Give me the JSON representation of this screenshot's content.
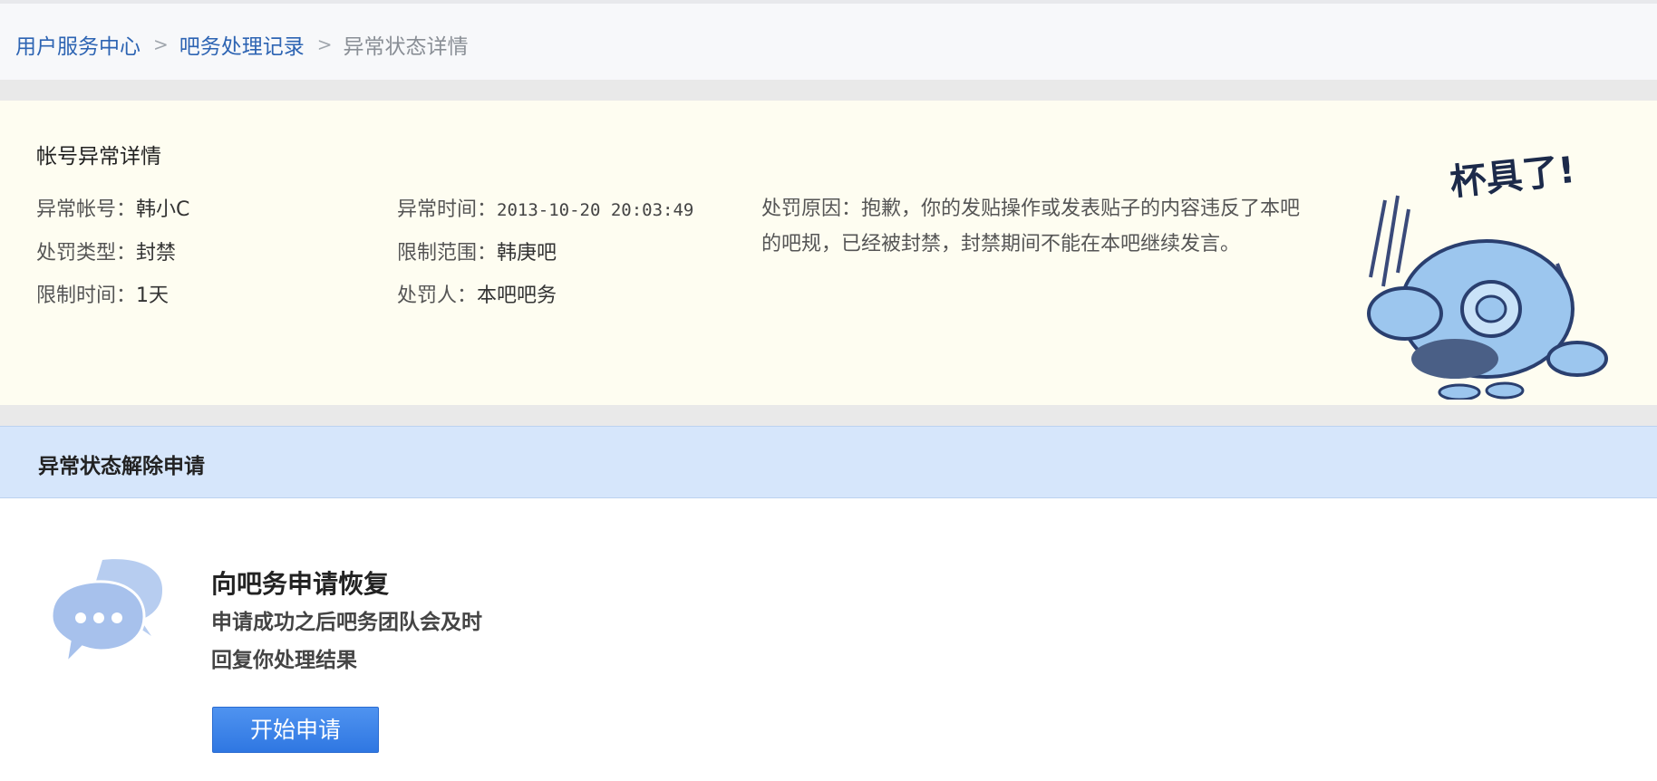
{
  "breadcrumb": {
    "items": [
      {
        "label": "用户服务中心"
      },
      {
        "label": "吧务处理记录"
      }
    ],
    "separator": ">",
    "current": "异常状态详情"
  },
  "detail": {
    "title": "帐号异常详情",
    "account_label": "异常帐号：",
    "account_value": "韩小C",
    "type_label": "处罚类型：",
    "type_value": "封禁",
    "duration_label": "限制时间：",
    "duration_value": "1天",
    "time_label": "异常时间：",
    "time_value": "2013-10-20 20:03:49",
    "scope_label": "限制范围：",
    "scope_value": "韩庚吧",
    "punisher_label": "处罚人：",
    "punisher_value": "本吧吧务",
    "reason_label": "处罚原因：",
    "reason_value": "抱歉，你的发贴操作或发表贴子的内容违反了本吧的吧规，已经被封禁，封禁期间不能在本吧继续发言。",
    "mascot_caption": "杯具了!"
  },
  "section": {
    "title": "异常状态解除申请"
  },
  "apply": {
    "title": "向吧务申请恢复",
    "desc_line1": "申请成功之后吧务团队会及时",
    "desc_line2": "回复你处理结果",
    "button_label": "开始申请"
  },
  "colors": {
    "link": "#2d64b3",
    "panel_bg": "#fefdf1",
    "section_bg": "#d6e6fb",
    "button": "#3a80e8"
  }
}
